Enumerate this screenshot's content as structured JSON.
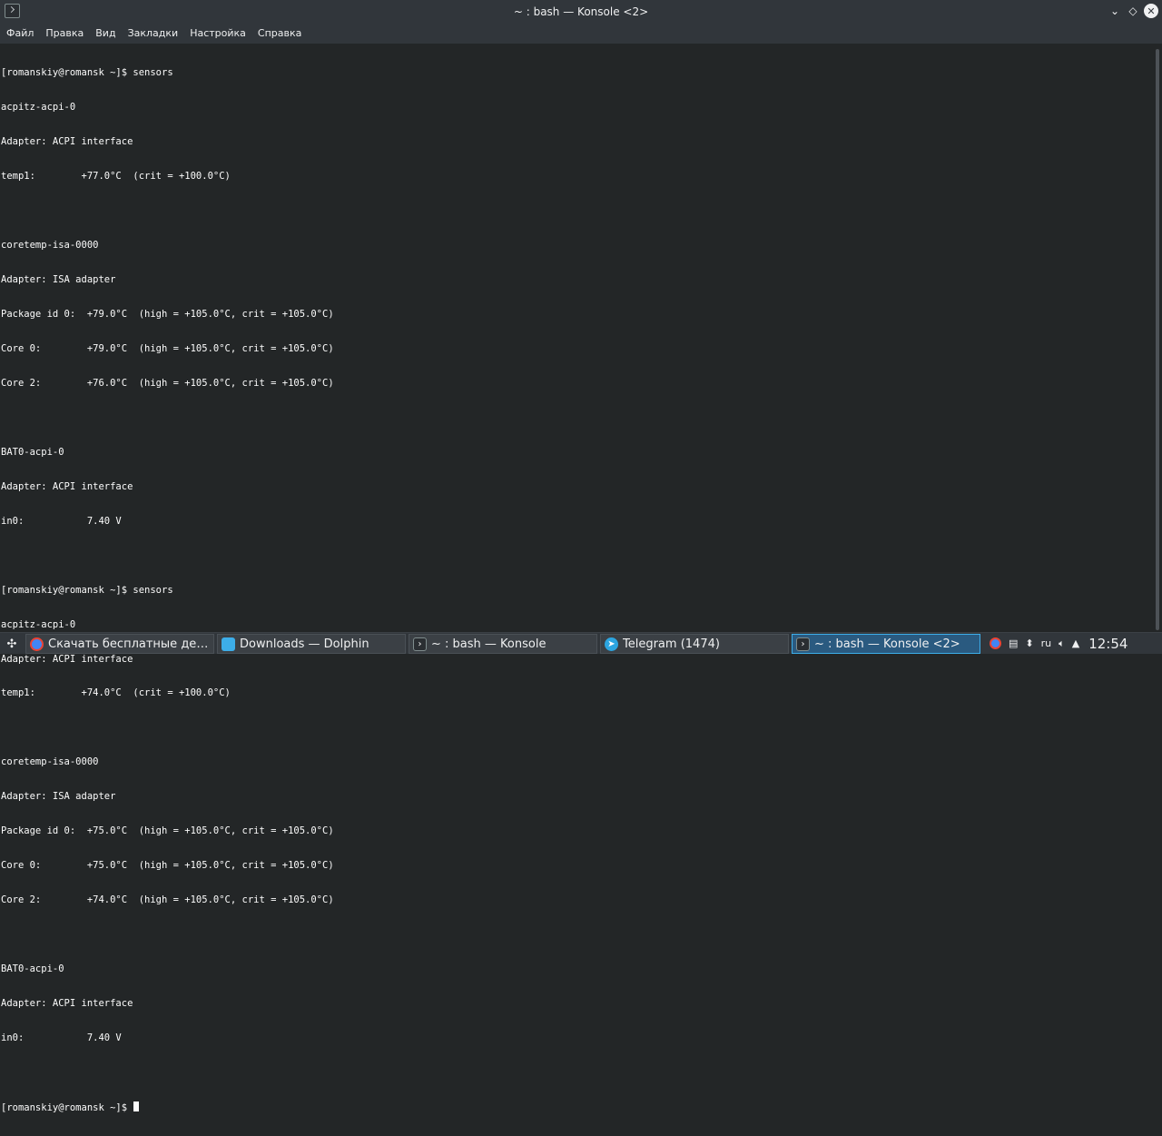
{
  "window": {
    "title": "~ : bash — Konsole <2>",
    "controls": {
      "minimize": "⌄",
      "maximize": "◇",
      "close": "✕"
    }
  },
  "menu": [
    "Файл",
    "Правка",
    "Вид",
    "Закладки",
    "Настройка",
    "Справка"
  ],
  "terminal": {
    "lines": [
      "[romanskiy@romansk ~]$ sensors",
      "acpitz-acpi-0",
      "Adapter: ACPI interface",
      "temp1:        +77.0°C  (crit = +100.0°C)",
      "",
      "coretemp-isa-0000",
      "Adapter: ISA adapter",
      "Package id 0:  +79.0°C  (high = +105.0°C, crit = +105.0°C)",
      "Core 0:        +79.0°C  (high = +105.0°C, crit = +105.0°C)",
      "Core 2:        +76.0°C  (high = +105.0°C, crit = +105.0°C)",
      "",
      "BAT0-acpi-0",
      "Adapter: ACPI interface",
      "in0:           7.40 V",
      "",
      "[romanskiy@romansk ~]$ sensors",
      "acpitz-acpi-0",
      "Adapter: ACPI interface",
      "temp1:        +74.0°C  (crit = +100.0°C)",
      "",
      "coretemp-isa-0000",
      "Adapter: ISA adapter",
      "Package id 0:  +75.0°C  (high = +105.0°C, crit = +105.0°C)",
      "Core 0:        +75.0°C  (high = +105.0°C, crit = +105.0°C)",
      "Core 2:        +74.0°C  (high = +105.0°C, crit = +105.0°C)",
      "",
      "BAT0-acpi-0",
      "Adapter: ACPI interface",
      "in0:           7.40 V",
      ""
    ],
    "prompt": "[romanskiy@romansk ~]$ "
  },
  "taskbar": {
    "tasks": [
      {
        "label": "Скачать бесплатные десктопные…",
        "icon": "chrome-icon"
      },
      {
        "label": "Downloads — Dolphin",
        "icon": "folder-icon"
      },
      {
        "label": "~ : bash — Konsole",
        "icon": "konsole-icon"
      },
      {
        "label": "Telegram (1474)",
        "icon": "telegram-icon"
      },
      {
        "label": "~ : bash — Konsole <2>",
        "icon": "konsole-icon",
        "active": true
      }
    ],
    "tray": {
      "language": "ru",
      "clock": "12:54"
    }
  },
  "colors": {
    "terminal_bg": "#232627",
    "chrome_bg": "#31363b",
    "text": "#fcfcfc",
    "active_task": "#2a5a80"
  }
}
